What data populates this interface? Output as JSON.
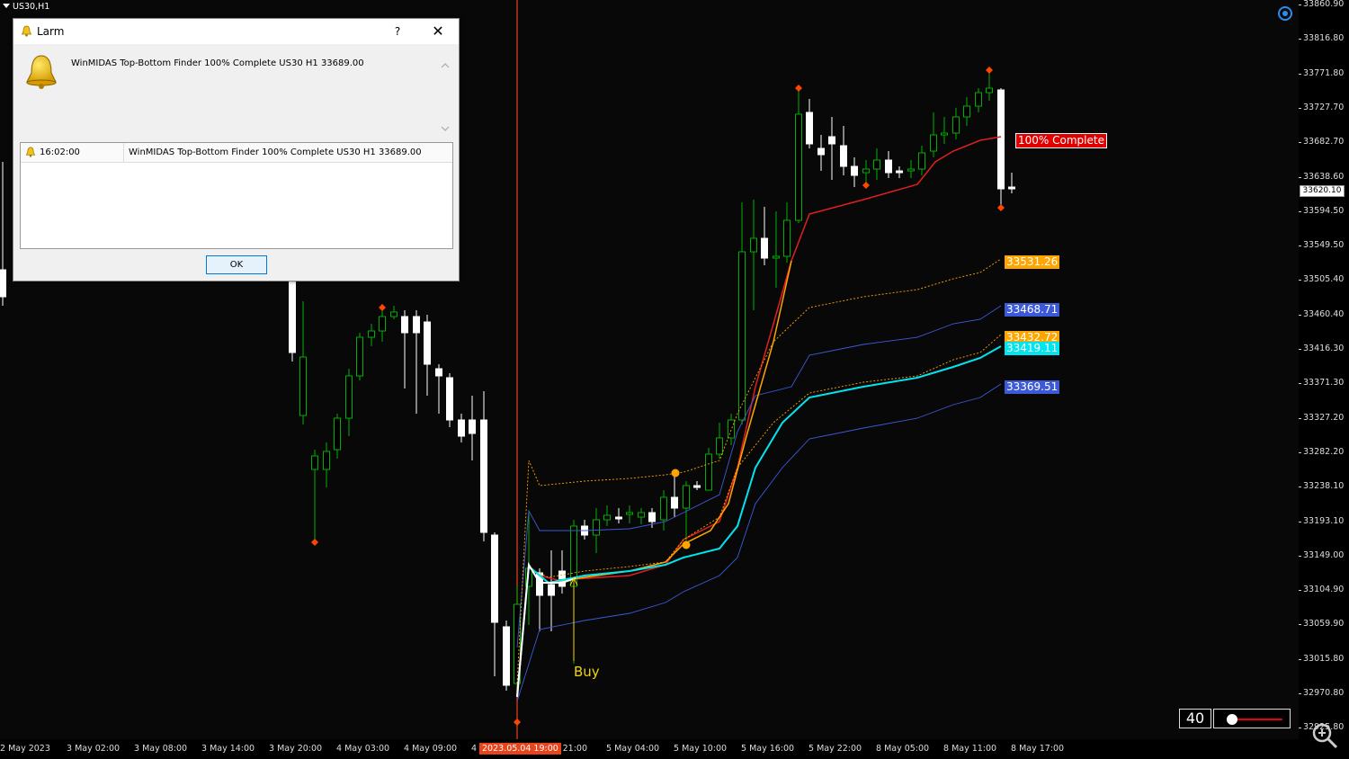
{
  "chart": {
    "symbol": "US30,H1",
    "current_price": "33620.10",
    "price_ticks": [
      "33860.90",
      "33816.80",
      "33771.80",
      "33727.70",
      "33682.70",
      "33638.60",
      "33594.50",
      "33549.50",
      "33505.40",
      "33460.40",
      "33416.30",
      "33371.30",
      "33327.20",
      "33282.20",
      "33238.10",
      "33193.10",
      "33149.00",
      "33104.90",
      "33059.90",
      "33015.80",
      "32970.80",
      "32925.80"
    ],
    "time_ticks": [
      "2 May 2023",
      "3 May 02:00",
      "3 May 08:00",
      "3 May 14:00",
      "3 May 20:00",
      "4 May 03:00",
      "4 May 09:00",
      "4",
      "y 21:00",
      "5 May 04:00",
      "5 May 10:00",
      "5 May 16:00",
      "5 May 22:00",
      "8 May 05:00",
      "8 May 11:00",
      "8 May 17:00"
    ],
    "time_marker": "2023.05.04 19:00",
    "buy_label": "Buy",
    "tags": [
      {
        "text": "100% Complete",
        "bg": "#e00000",
        "fg": "#ffffff"
      },
      {
        "text": "33531.26",
        "bg": "#ffa500",
        "fg": "#ffffff"
      },
      {
        "text": "33468.71",
        "bg": "#3c5ad8",
        "fg": "#ffffff"
      },
      {
        "text": "33432.72",
        "bg": "#ffa500",
        "fg": "#ffffff"
      },
      {
        "text": "33419.11",
        "bg": "#00e5ee",
        "fg": "#ffffff"
      },
      {
        "text": "33369.51",
        "bg": "#3c5ad8",
        "fg": "#ffffff"
      }
    ],
    "zoom_value": "40",
    "colors": {
      "bull": "#00b000",
      "bear": "#ffffff",
      "red_line": "#e02020",
      "orange": "#ffa500",
      "cyan": "#00e5ee",
      "blue": "#3c5ad8",
      "marker": "#ff4500",
      "buy": "#f3d400"
    }
  },
  "dialog": {
    "title": "Larm",
    "help": "?",
    "close": "✕",
    "message": "WinMIDAS Top-Bottom Finder 100% Complete US30 H1 33689.00",
    "row_time": "16:02:00",
    "row_message": "WinMIDAS Top-Bottom Finder 100% Complete US30 H1 33689.00",
    "ok_label": "OK"
  }
}
